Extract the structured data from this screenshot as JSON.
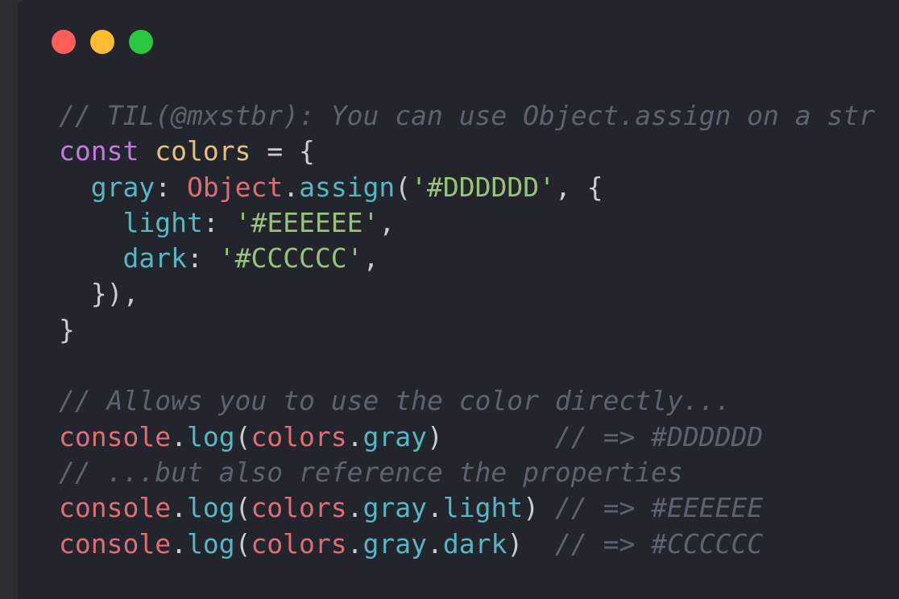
{
  "window": {
    "controls": [
      {
        "name": "close",
        "color": "#ff5f57"
      },
      {
        "name": "minimize",
        "color": "#febc2e"
      },
      {
        "name": "maximize",
        "color": "#28c840"
      }
    ]
  },
  "colors": {
    "background": "#22252c",
    "comment": "#5c6270",
    "keyword": "#c678dd",
    "variable": "#e5c07b",
    "property": "#56b6c2",
    "object": "#e06c75",
    "string": "#98c379",
    "punctuation": "#c9ccd3"
  },
  "code": {
    "lines": [
      [
        {
          "t": "comment",
          "v": "// TIL(@mxstbr): You can use Object.assign on a str"
        }
      ],
      [
        {
          "t": "keyword",
          "v": "const"
        },
        {
          "t": "punct",
          "v": " "
        },
        {
          "t": "var",
          "v": "colors"
        },
        {
          "t": "punct",
          "v": " = {"
        }
      ],
      [
        {
          "t": "punct",
          "v": "  "
        },
        {
          "t": "prop",
          "v": "gray"
        },
        {
          "t": "punct",
          "v": ": "
        },
        {
          "t": "obj",
          "v": "Object"
        },
        {
          "t": "punct",
          "v": "."
        },
        {
          "t": "func",
          "v": "assign"
        },
        {
          "t": "punct",
          "v": "("
        },
        {
          "t": "str",
          "v": "'#DDDDDD'"
        },
        {
          "t": "punct",
          "v": ", {"
        }
      ],
      [
        {
          "t": "punct",
          "v": "    "
        },
        {
          "t": "prop",
          "v": "light"
        },
        {
          "t": "punct",
          "v": ": "
        },
        {
          "t": "str",
          "v": "'#EEEEEE'"
        },
        {
          "t": "punct",
          "v": ","
        }
      ],
      [
        {
          "t": "punct",
          "v": "    "
        },
        {
          "t": "prop",
          "v": "dark"
        },
        {
          "t": "punct",
          "v": ": "
        },
        {
          "t": "str",
          "v": "'#CCCCCC'"
        },
        {
          "t": "punct",
          "v": ","
        }
      ],
      [
        {
          "t": "punct",
          "v": "  }),"
        }
      ],
      [
        {
          "t": "punct",
          "v": "}"
        }
      ],
      [],
      [
        {
          "t": "comment",
          "v": "// Allows you to use the color directly..."
        }
      ],
      [
        {
          "t": "obj",
          "v": "console"
        },
        {
          "t": "punct",
          "v": "."
        },
        {
          "t": "func",
          "v": "log"
        },
        {
          "t": "punct",
          "v": "("
        },
        {
          "t": "obj",
          "v": "colors"
        },
        {
          "t": "punct",
          "v": "."
        },
        {
          "t": "prop",
          "v": "gray"
        },
        {
          "t": "punct",
          "v": ")       "
        },
        {
          "t": "comment",
          "v": "// => #DDDDDD"
        }
      ],
      [
        {
          "t": "comment",
          "v": "// ...but also reference the properties"
        }
      ],
      [
        {
          "t": "obj",
          "v": "console"
        },
        {
          "t": "punct",
          "v": "."
        },
        {
          "t": "func",
          "v": "log"
        },
        {
          "t": "punct",
          "v": "("
        },
        {
          "t": "obj",
          "v": "colors"
        },
        {
          "t": "punct",
          "v": "."
        },
        {
          "t": "prop",
          "v": "gray"
        },
        {
          "t": "punct",
          "v": "."
        },
        {
          "t": "prop",
          "v": "light"
        },
        {
          "t": "punct",
          "v": ") "
        },
        {
          "t": "comment",
          "v": "// => #EEEEEE"
        }
      ],
      [
        {
          "t": "obj",
          "v": "console"
        },
        {
          "t": "punct",
          "v": "."
        },
        {
          "t": "func",
          "v": "log"
        },
        {
          "t": "punct",
          "v": "("
        },
        {
          "t": "obj",
          "v": "colors"
        },
        {
          "t": "punct",
          "v": "."
        },
        {
          "t": "prop",
          "v": "gray"
        },
        {
          "t": "punct",
          "v": "."
        },
        {
          "t": "prop",
          "v": "dark"
        },
        {
          "t": "punct",
          "v": ")  "
        },
        {
          "t": "comment",
          "v": "// => #CCCCCC"
        }
      ]
    ]
  }
}
